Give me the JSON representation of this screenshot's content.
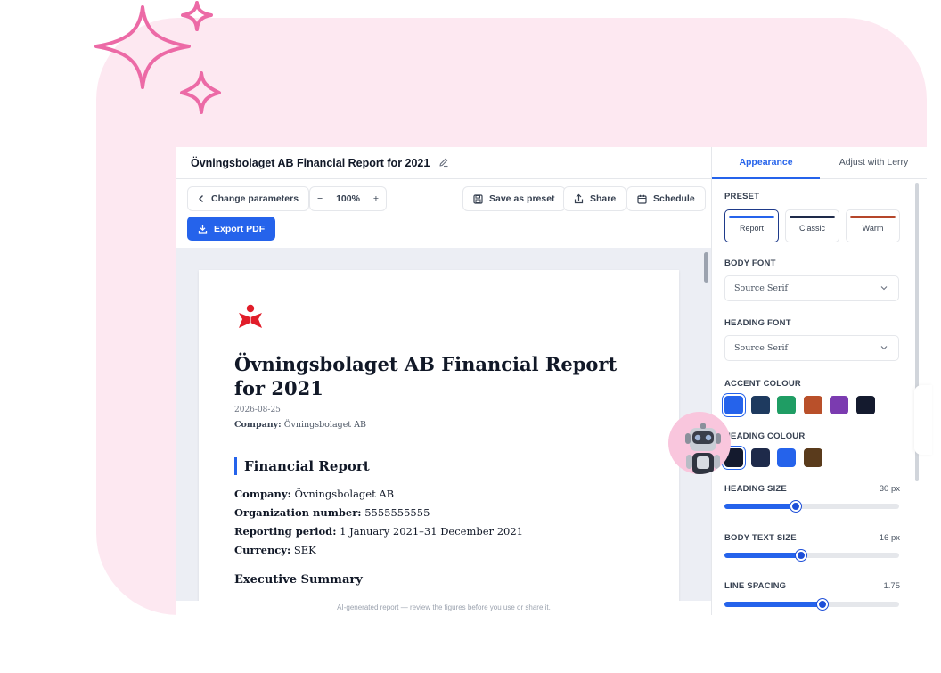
{
  "document": {
    "title": "Övningsbolaget AB Financial Report for 2021"
  },
  "toolbar": {
    "change_parameters": "Change parameters",
    "zoom_minus": "−",
    "zoom_value": "100%",
    "zoom_plus": "+",
    "save_preset": "Save as preset",
    "share": "Share",
    "schedule": "Schedule",
    "export_pdf": "Export PDF"
  },
  "report": {
    "title": "Övningsbolaget AB Financial Report for 2021",
    "date": "2026-08-25",
    "company_label": "Company:",
    "company_value": "Övningsbolaget AB",
    "section_title": "Financial Report",
    "facts": [
      {
        "label": "Company:",
        "value": "Övningsbolaget AB"
      },
      {
        "label": "Organization number:",
        "value": "5555555555"
      },
      {
        "label": "Reporting period:",
        "value": "1 January 2021–31 December 2021"
      },
      {
        "label": "Currency:",
        "value": "SEK"
      }
    ],
    "subheading": "Executive Summary"
  },
  "footer_note": "AI-generated report — review the figures before you use or share it.",
  "panel": {
    "tabs": [
      "Appearance",
      "Adjust with Lerry"
    ],
    "preset_label": "PRESET",
    "presets": [
      {
        "label": "Report",
        "color": "#2563eb",
        "selected": true
      },
      {
        "label": "Classic",
        "color": "#1e2a4a",
        "selected": false
      },
      {
        "label": "Warm",
        "color": "#b5462a",
        "selected": false
      }
    ],
    "body_font_label": "BODY FONT",
    "body_font_value": "Source Serif",
    "heading_font_label": "HEADING FONT",
    "heading_font_value": "Source Serif",
    "accent_label": "ACCENT COLOUR",
    "accent_colors": [
      "#2563eb",
      "#1e3a5f",
      "#1f9d64",
      "#b9502a",
      "#7b3bb0",
      "#141a2e"
    ],
    "accent_selected": 0,
    "heading_colour_label": "HEADING COLOUR",
    "heading_colors": [
      "#141a2e",
      "#1e2a4a",
      "#2563eb",
      "#5a3b1c"
    ],
    "heading_selected": 0,
    "heading_size_label": "HEADING SIZE",
    "heading_size_value": "30 px",
    "heading_size_level": 0.41,
    "body_size_label": "BODY TEXT SIZE",
    "body_size_value": "16 px",
    "body_size_level": 0.44,
    "line_spacing_label": "LINE SPACING",
    "line_spacing_value": "1.75",
    "line_spacing_level": 0.56
  }
}
